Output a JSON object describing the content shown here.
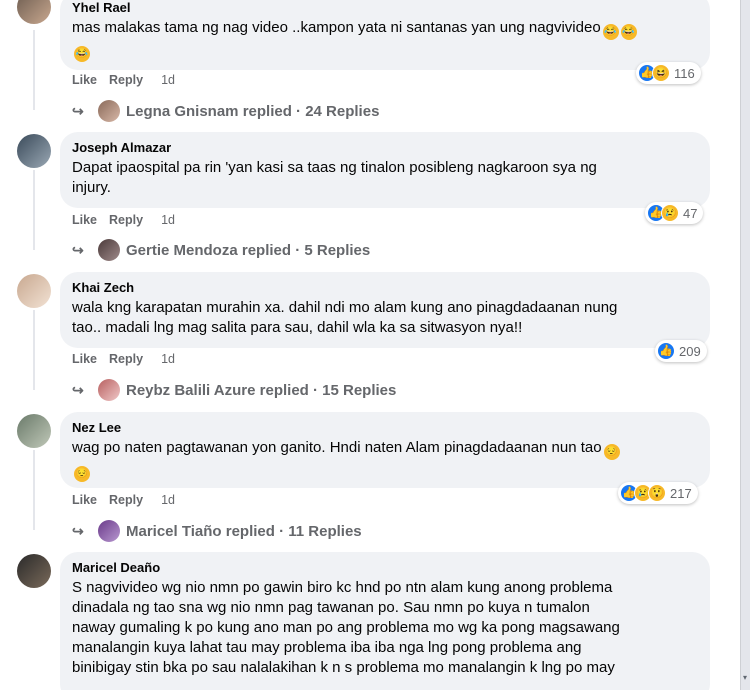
{
  "comments": [
    {
      "author": "Yhel Rael",
      "text": "mas malakas tama ng nag video ..kampon yata ni santanas yan ung nagvivideo",
      "like": "Like",
      "reply": "Reply",
      "time": "1d",
      "reaction_count": "116",
      "reactions": [
        "like-icon",
        "haha-icon"
      ],
      "replies_text": "Legna Gnisnam replied · 24 Replies"
    },
    {
      "author": "Joseph Almazar",
      "text_line1": "Dapat ipaospital pa rin 'yan kasi sa taas ng tinalon posibleng nagkaroon sya ng",
      "text_line2": "injury.",
      "like": "Like",
      "reply": "Reply",
      "time": "1d",
      "reaction_count": "47",
      "reactions": [
        "like-icon",
        "sad-icon"
      ],
      "replies_text": "Gertie Mendoza replied · 5 Replies"
    },
    {
      "author": "Khai Zech",
      "text_line1": "wala kng karapatan murahin xa. dahil ndi mo alam kung ano pinagdadaanan nung",
      "text_line2": "tao.. madali lng mag salita para sau, dahil wla ka sa sitwasyon nya!!",
      "like": "Like",
      "reply": "Reply",
      "time": "1d",
      "reaction_count": "209",
      "reactions": [
        "like-icon"
      ],
      "replies_text": "Reybz Balili Azure replied · 15 Replies"
    },
    {
      "author": "Nez Lee",
      "text": "wag po naten pagtawanan yon ganito. Hndi naten Alam pinagdadaanan nun tao",
      "like": "Like",
      "reply": "Reply",
      "time": "1d",
      "reaction_count": "217",
      "reactions": [
        "like-icon",
        "sad-icon",
        "wow-icon"
      ],
      "replies_text": "Maricel Tiaño replied · 11 Replies"
    },
    {
      "author": "Maricel Deaño",
      "text_line1": "S nagvivideo wg nio nmn po gawin biro kc hnd po ntn alam kung anong problema",
      "text_line2": "dinadala ng tao sna wg nio nmn pag tawanan po. Sau nmn po kuya n tumalon",
      "text_line3": "naway gumaling k po kung ano man po ang problema mo wg ka pong magsawang",
      "text_line4": "manalangin kuya lahat tau may problema iba iba nga lng pong problema ang",
      "text_line5": "binibigay stin bka po sau nalalakihan k n s problema mo manalangin k lng po may"
    }
  ],
  "colors": {
    "bubble": "#f0f2f5",
    "like_blue": "#1877f2",
    "emoji_yellow": "#f7b928",
    "meta_gray": "#65676b"
  }
}
